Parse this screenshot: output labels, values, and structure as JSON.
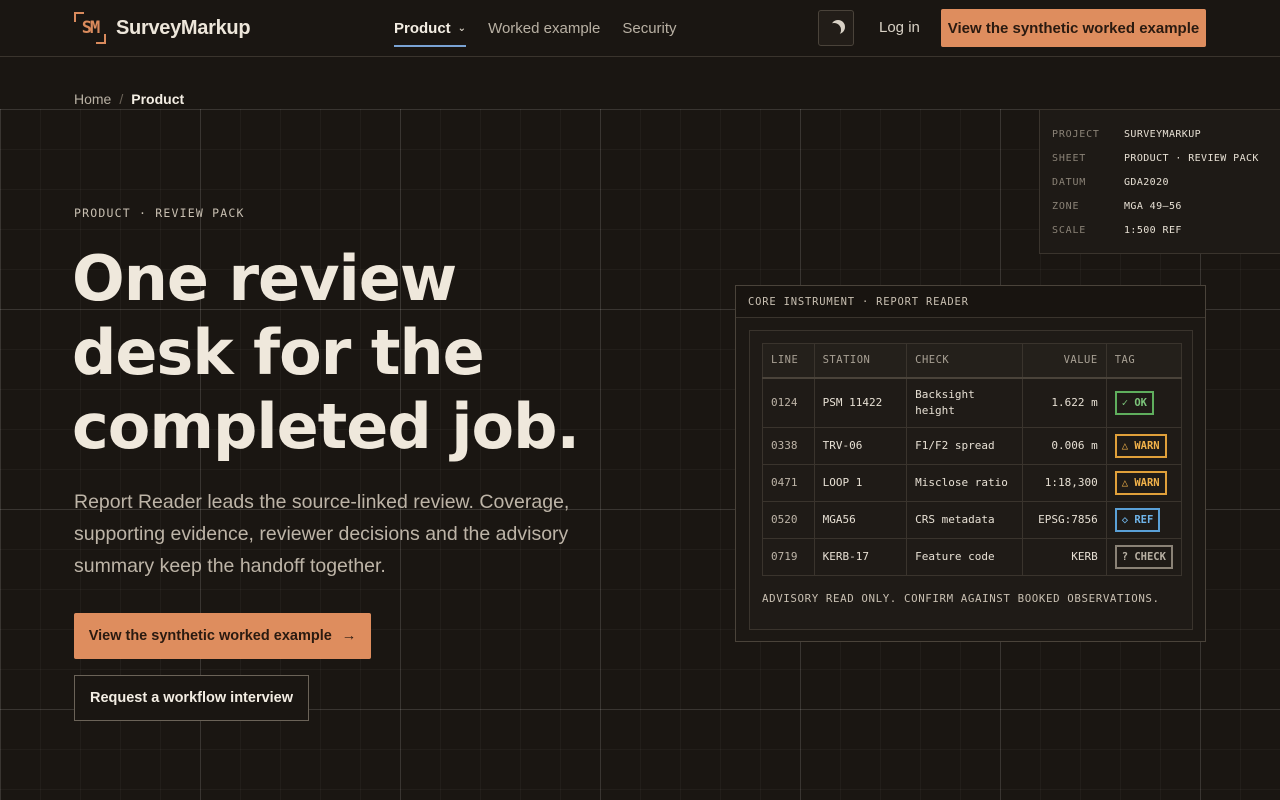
{
  "brand": {
    "logo_mark": "SM",
    "name": "SurveyMarkup",
    "accent": "#de8d5e"
  },
  "nav": {
    "items": [
      {
        "label": "Product",
        "active": true
      },
      {
        "label": "Worked example",
        "active": false
      },
      {
        "label": "Security",
        "active": false
      }
    ],
    "theme_icon": "moon-icon",
    "login_label": "Log in",
    "cta_label": "View the synthetic worked example"
  },
  "breadcrumb": {
    "home": "Home",
    "separator": "/",
    "current": "Product"
  },
  "hero": {
    "eyebrow": "PRODUCT · REVIEW PACK",
    "headline": [
      "One review",
      "desk for the",
      "completed job."
    ],
    "lede": "Report Reader leads the source-linked review. Coverage, supporting evidence, reviewer decisions and the advisory summary keep the handoff together.",
    "primary_label": "View the synthetic worked example",
    "primary_arrow": "→",
    "secondary_label": "Request a workflow interview"
  },
  "titleblock": {
    "rows": [
      {
        "label": "PROJECT",
        "value": "SURVEYMARKUP"
      },
      {
        "label": "SHEET",
        "value": "PRODUCT · REVIEW PACK"
      },
      {
        "label": "DATUM",
        "value": "GDA2020"
      },
      {
        "label": "ZONE",
        "value": "MGA 49–56"
      },
      {
        "label": "SCALE",
        "value": "1:500 REF"
      }
    ]
  },
  "instrument": {
    "title": "CORE INSTRUMENT · REPORT READER",
    "columns": [
      "LINE",
      "STATION",
      "CHECK",
      "VALUE",
      "TAG"
    ],
    "rows": [
      {
        "line": "0124",
        "station": "PSM 11422",
        "check": "Backsight height",
        "value": "1.622 m",
        "tag": "✓ OK",
        "tag_type": "ok"
      },
      {
        "line": "0338",
        "station": "TRV-06",
        "check": "F1/F2 spread",
        "value": "0.006 m",
        "tag": "△ WARN",
        "tag_type": "warn"
      },
      {
        "line": "0471",
        "station": "LOOP 1",
        "check": "Misclose ratio",
        "value": "1:18,300",
        "tag": "△ WARN",
        "tag_type": "warn"
      },
      {
        "line": "0520",
        "station": "MGA56",
        "check": "CRS metadata",
        "value": "EPSG:7856",
        "tag": "◇ REF",
        "tag_type": "ref"
      },
      {
        "line": "0719",
        "station": "KERB-17",
        "check": "Feature code",
        "value": "KERB",
        "tag": "? CHECK",
        "tag_type": "check"
      }
    ],
    "advisory": "ADVISORY READ ONLY. CONFIRM AGAINST BOOKED OBSERVATIONS."
  }
}
